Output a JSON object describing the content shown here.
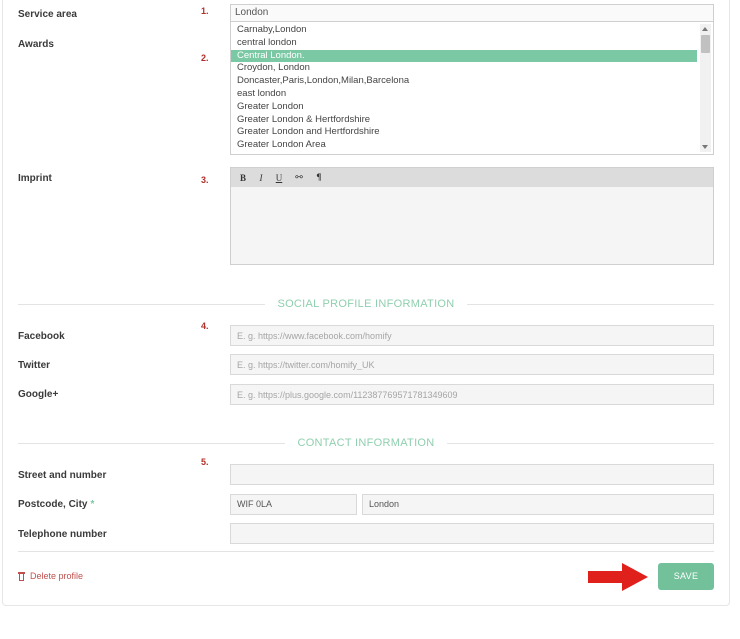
{
  "labels": {
    "service_area": "Service area",
    "awards": "Awards",
    "imprint": "Imprint",
    "facebook": "Facebook",
    "twitter": "Twitter",
    "google": "Google+",
    "street": "Street and number",
    "postcode_city": "Postcode, City",
    "required_mark": "*",
    "telephone": "Telephone number"
  },
  "step_numbers": [
    "1.",
    "2.",
    "3.",
    "4.",
    "5."
  ],
  "service_area": {
    "input_value": "London",
    "options": [
      "Carnaby,London",
      "central london",
      "Central London.",
      "Croydon, London",
      "Doncaster,Paris,London,Milan,Barcelona",
      "east london",
      "Greater London",
      "Greater London & Hertfordshire",
      "Greater London and Hertfordshire",
      "Greater London Area"
    ],
    "selected_index": 2
  },
  "editor": {
    "toolbar": {
      "bold": "B",
      "italic": "I",
      "underline": "U",
      "link": "⚯",
      "paragraph": "¶"
    }
  },
  "sections": {
    "social": "SOCIAL PROFILE INFORMATION",
    "contact": "CONTACT INFORMATION"
  },
  "social": {
    "facebook_placeholder": "E. g. https://www.facebook.com/homify",
    "twitter_placeholder": "E. g. https://twitter.com/homify_UK",
    "google_placeholder": "E. g. https://plus.google.com/112387769571781349609"
  },
  "contact": {
    "street_value": "",
    "postcode_value": "WIF 0LA",
    "city_value": "London",
    "telephone_value": ""
  },
  "actions": {
    "delete_label": "Delete profile",
    "save_label": "SAVE"
  },
  "colors": {
    "accent": "#72c19b",
    "section_title": "#8fcfae",
    "step_number": "#b0302a",
    "delete": "#c0504d",
    "arrow": "#e0201b"
  }
}
